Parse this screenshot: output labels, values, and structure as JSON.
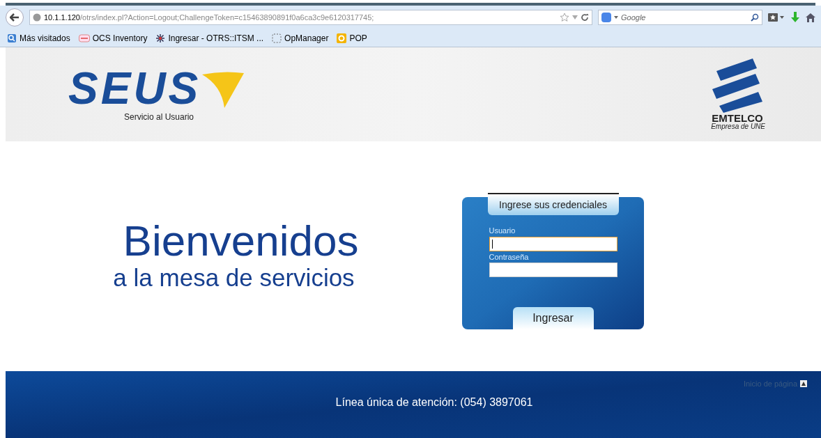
{
  "browser": {
    "url_host": "10.1.1.120",
    "url_path": "/otrs/index.pl?Action=Logout;ChallengeToken=c15463890891f0a6ca3c9e6120317745;",
    "search_placeholder": "Google",
    "bookmarks": [
      {
        "label": "Más visitados",
        "kind": "search"
      },
      {
        "label": "OCS Inventory",
        "kind": "ocs"
      },
      {
        "label": "Ingresar - OTRS::ITSM ...",
        "kind": "star"
      },
      {
        "label": "OpManager",
        "kind": "dotted"
      },
      {
        "label": "POP",
        "kind": "office"
      }
    ]
  },
  "header": {
    "logo_text": "SEUS",
    "logo_subtitle": "Servicio al Usuario",
    "brand_name": "EMTELCO",
    "brand_subtitle": "Empresa de UNE"
  },
  "welcome": {
    "title": "Bienvenidos",
    "subtitle": "a la mesa de servicios"
  },
  "login": {
    "title": "Ingrese sus credenciales",
    "fields": [
      {
        "label": "Usuario",
        "focused": true
      },
      {
        "label": "Contraseña",
        "focused": false
      }
    ],
    "button": "Ingresar"
  },
  "footer": {
    "contact": "Línea única de atención: (054) 3897061",
    "top_link": "Inicio de página"
  }
}
